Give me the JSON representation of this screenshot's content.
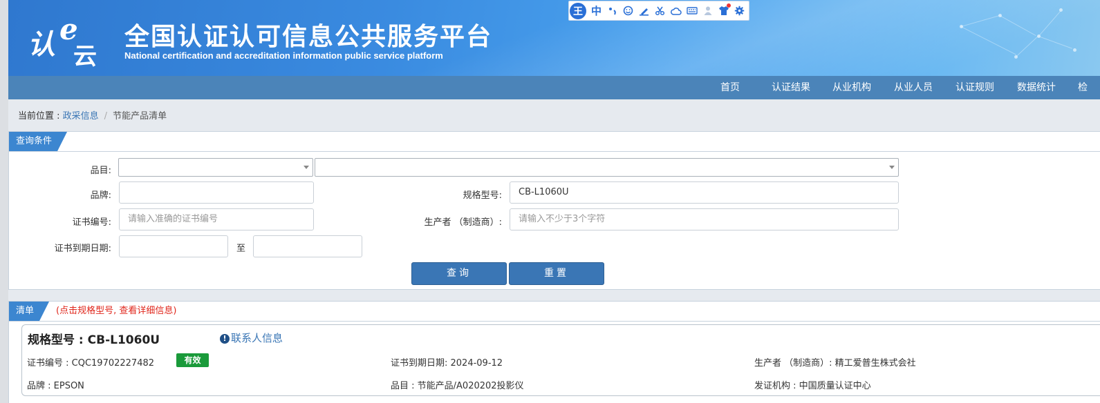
{
  "header": {
    "logo_text": [
      "认",
      "e",
      "云"
    ],
    "title": "全国认证认可信息公共服务平台",
    "subtitle": "National certification and accreditation information public service platform"
  },
  "ime_toolbar": {
    "brand": "王",
    "mode": "中",
    "icons": [
      "punctuation-icon",
      "emoji-icon",
      "pen-icon",
      "scissors-icon",
      "cloud-icon",
      "keyboard-icon",
      "person-icon",
      "skin-icon",
      "settings-icon"
    ]
  },
  "nav": {
    "items": [
      "首页",
      "认证结果",
      "从业机构",
      "从业人员",
      "认证规则",
      "数据统计",
      "检"
    ]
  },
  "breadcrumb": {
    "prefix": "当前位置 : ",
    "link": "政采信息",
    "separator": "/",
    "current": "节能产品清单"
  },
  "query_panel": {
    "tab": "查询条件",
    "labels": {
      "category": "品目:",
      "brand": "品牌:",
      "model": "规格型号:",
      "cert_no": "证书编号:",
      "manufacturer": "生产者 （制造商）:",
      "expiry": "证书到期日期:",
      "to": "至"
    },
    "values": {
      "category_1": "",
      "category_2": "",
      "brand": "",
      "model": "CB-L1060U",
      "date_from": "",
      "date_to": ""
    },
    "placeholders": {
      "cert_no": "请输入准确的证书编号",
      "manufacturer": "请输入不少于3个字符"
    },
    "buttons": {
      "query": "查询",
      "reset": "重置"
    }
  },
  "list_panel": {
    "tab": "清单",
    "hint": "(点击规格型号, 查看详细信息)",
    "result": {
      "title": "规格型号 : CB-L1060U",
      "contact": "联系人信息",
      "cert_no": "证书编号 : CQC19702227482",
      "status": "有效",
      "expiry": "证书到期日期: 2024-09-12",
      "manufacturer": "生产者 （制造商）: 精工爱普生株式会社",
      "brand": "品牌 : EPSON",
      "category": "品目 : 节能产品/A020202投影仪",
      "issuer": "发证机构 : 中国质量认证中心"
    }
  },
  "colors": {
    "header_blue": "#3a8be0",
    "nav_blue": "#4b84b9",
    "tab_blue": "#3c86d0",
    "button_blue": "#3a76b5",
    "hint_red": "#e0261b",
    "status_green": "#1a9a3a"
  }
}
